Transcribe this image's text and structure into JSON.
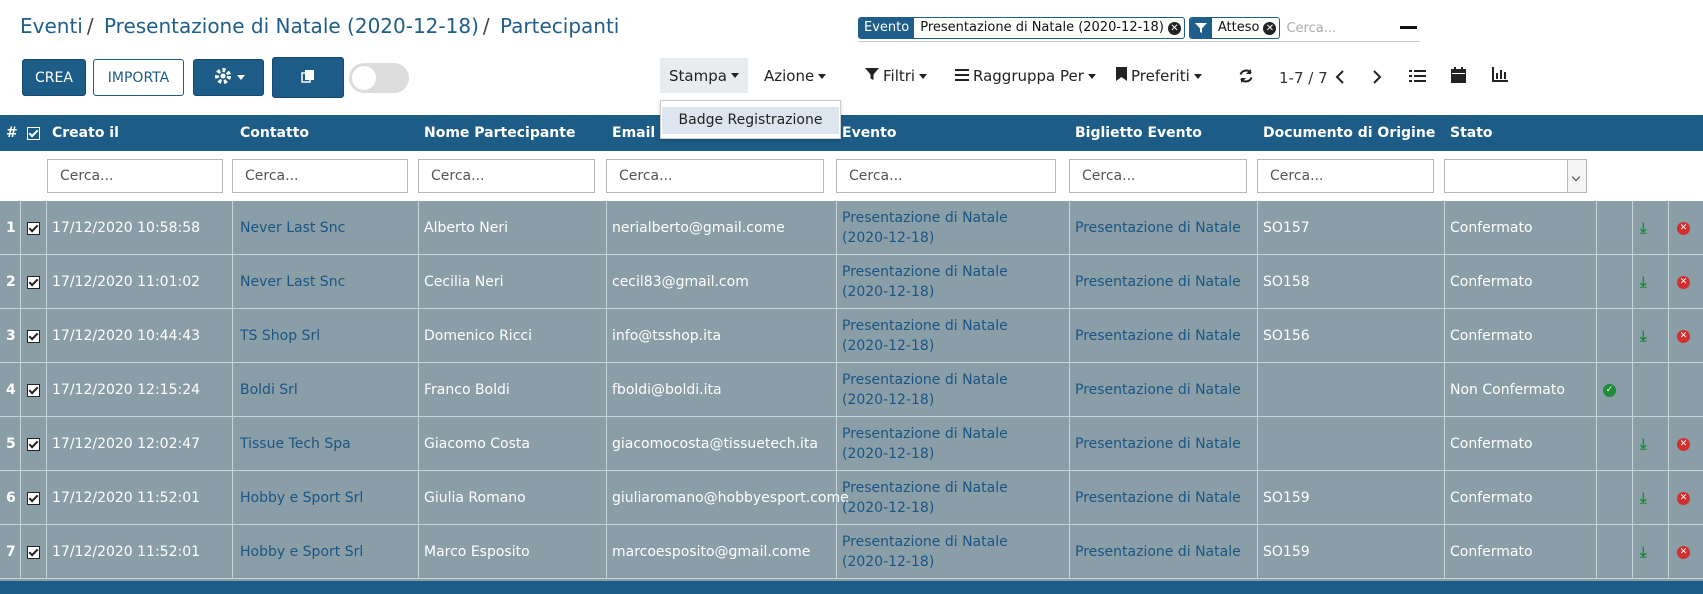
{
  "breadcrumb": {
    "items": [
      "Eventi",
      "Presentazione di Natale (2020-12-18)",
      "Partecipanti"
    ],
    "sep": "/"
  },
  "search": {
    "facets": [
      {
        "label": "Evento",
        "value": "Presentazione di Natale (2020-12-18)"
      },
      {
        "label": "",
        "value": "Atteso"
      }
    ],
    "placeholder": "Cerca..."
  },
  "toolbar": {
    "create_label": "CREA",
    "import_label": "IMPORTA"
  },
  "controls": {
    "stampa": "Stampa",
    "azione": "Azione",
    "filtri": "Filtri",
    "raggruppa": "Raggruppa Per",
    "preferiti": "Preferiti",
    "pager": "1-7 / 7"
  },
  "dropdown": {
    "items": [
      "Badge Registrazione"
    ]
  },
  "table": {
    "columns": [
      "#",
      "Creato il",
      "Contatto",
      "Nome Partecipante",
      "Email",
      "Evento",
      "Biglietto Evento",
      "Documento di Origine",
      "Stato"
    ],
    "filter_placeholder": "Cerca...",
    "rows": [
      {
        "num": "1",
        "created": "17/12/2020 10:58:58",
        "contact": "Never Last Snc",
        "name": "Alberto Neri",
        "email": "nerialberto@gmail.come",
        "event": "Presentazione di Natale (2020-12-18)",
        "ticket": "Presentazione di Natale",
        "origin": "SO157",
        "state": "Confermato",
        "confirm_icon": false,
        "arrow_icon": true
      },
      {
        "num": "2",
        "created": "17/12/2020 11:01:02",
        "contact": "Never Last Snc",
        "name": "Cecilia Neri",
        "email": "cecil83@gmail.com",
        "event": "Presentazione di Natale (2020-12-18)",
        "ticket": "Presentazione di Natale",
        "origin": "SO158",
        "state": "Confermato",
        "confirm_icon": false,
        "arrow_icon": true
      },
      {
        "num": "3",
        "created": "17/12/2020 10:44:43",
        "contact": "TS Shop Srl",
        "name": "Domenico Ricci",
        "email": "info@tsshop.ita",
        "event": "Presentazione di Natale (2020-12-18)",
        "ticket": "Presentazione di Natale",
        "origin": "SO156",
        "state": "Confermato",
        "confirm_icon": false,
        "arrow_icon": true
      },
      {
        "num": "4",
        "created": "17/12/2020 12:15:24",
        "contact": "Boldi Srl",
        "name": "Franco Boldi",
        "email": "fboldi@boldi.ita",
        "event": "Presentazione di Natale (2020-12-18)",
        "ticket": "Presentazione di Natale",
        "origin": "",
        "state": "Non Confermato",
        "confirm_icon": true,
        "arrow_icon": false
      },
      {
        "num": "5",
        "created": "17/12/2020 12:02:47",
        "contact": "Tissue Tech Spa",
        "name": "Giacomo Costa",
        "email": "giacomocosta@tissuetech.ita",
        "event": "Presentazione di Natale (2020-12-18)",
        "ticket": "Presentazione di Natale",
        "origin": "",
        "state": "Confermato",
        "confirm_icon": false,
        "arrow_icon": true
      },
      {
        "num": "6",
        "created": "17/12/2020 11:52:01",
        "contact": "Hobby e Sport Srl",
        "name": "Giulia Romano",
        "email": "giuliaromano@hobbyesport.come",
        "event": "Presentazione di Natale (2020-12-18)",
        "ticket": "Presentazione di Natale",
        "origin": "SO159",
        "state": "Confermato",
        "confirm_icon": false,
        "arrow_icon": true
      },
      {
        "num": "7",
        "created": "17/12/2020 11:52:01",
        "contact": "Hobby e Sport Srl",
        "name": "Marco Esposito",
        "email": "marcoesposito@gmail.come",
        "event": "Presentazione di Natale (2020-12-18)",
        "ticket": "Presentazione di Natale",
        "origin": "SO159",
        "state": "Confermato",
        "confirm_icon": false,
        "arrow_icon": true
      }
    ]
  },
  "colors": {
    "primary": "#1d5c87",
    "row_bg": "#8a9ea8",
    "link": "#1a5582",
    "success": "#1f8a3a",
    "danger": "#d32f2f"
  },
  "icons": {
    "settings": "gear-icon",
    "duplicate": "copy-icon",
    "refresh": "refresh-icon",
    "prev": "chevron-left-icon",
    "next": "chevron-right-icon",
    "list_view": "list-icon",
    "calendar_view": "calendar-icon",
    "graph_view": "chart-icon"
  }
}
